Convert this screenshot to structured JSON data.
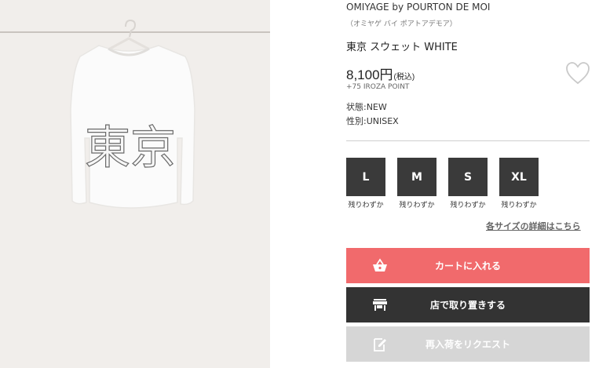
{
  "product": {
    "brand": "OMIYAGE by POURTON DE MOI",
    "brand_kana": "（オミヤゲ バイ ポアトアデモア）",
    "name": "東京 スウェット WHITE",
    "price": "8,100円",
    "tax_note": "(税込)",
    "points": "+75 IROZA POINT",
    "condition": "状態:NEW",
    "gender": "性別:UNISEX",
    "print_text": "東京",
    "favorite_icon": "heart-outline-icon"
  },
  "sizes": [
    {
      "label": "L",
      "stock": "残りわずか"
    },
    {
      "label": "M",
      "stock": "残りわずか"
    },
    {
      "label": "S",
      "stock": "残りわずか"
    },
    {
      "label": "XL",
      "stock": "残りわずか"
    }
  ],
  "size_detail_link": "各サイズの詳細はこちら",
  "actions": {
    "cart": {
      "label": "カートに入れる",
      "icon": "basket-icon",
      "color": "#f16a6c"
    },
    "store": {
      "label": "店で取り置きする",
      "icon": "store-icon",
      "color": "#333333"
    },
    "restock": {
      "label": "再入荷をリクエスト",
      "icon": "edit-request-icon",
      "color": "#d6d6d6"
    }
  }
}
